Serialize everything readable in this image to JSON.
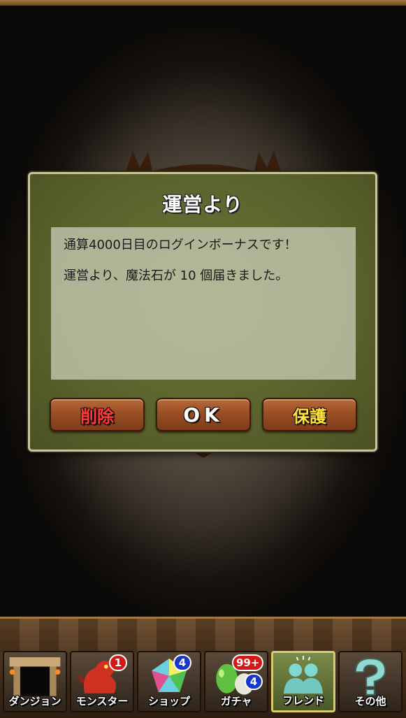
{
  "dialog": {
    "title": "運営より",
    "message_lines": [
      "通算4000日目のログインボーナスです！",
      "運営より、魔法石が  10  個届きました。"
    ],
    "buttons": {
      "delete": "削除",
      "ok": "OK",
      "protect": "保護"
    }
  },
  "nav": {
    "items": [
      {
        "label": "ダンジョン",
        "icon": "dungeon-gate-icon"
      },
      {
        "label": "モンスター",
        "icon": "dragon-icon",
        "badge": "1",
        "badge_color": "#d41818"
      },
      {
        "label": "ショップ",
        "icon": "gem-icon",
        "badge": "4",
        "badge_color": "#1838c8"
      },
      {
        "label": "ガチャ",
        "icon": "egg-icon",
        "badge_top": "99+",
        "badge_top_color": "#d41818",
        "badge": "4",
        "badge_color": "#1838c8"
      },
      {
        "label": "フレンド",
        "icon": "friends-icon",
        "active": true
      },
      {
        "label": "その他",
        "icon": "question-icon"
      }
    ]
  },
  "colors": {
    "dialog_bg": "#5b622c",
    "button_bg": "#9a4f26",
    "delete_text": "#ff3b3b",
    "ok_text": "#ffffff",
    "protect_text": "#ffe23a"
  }
}
